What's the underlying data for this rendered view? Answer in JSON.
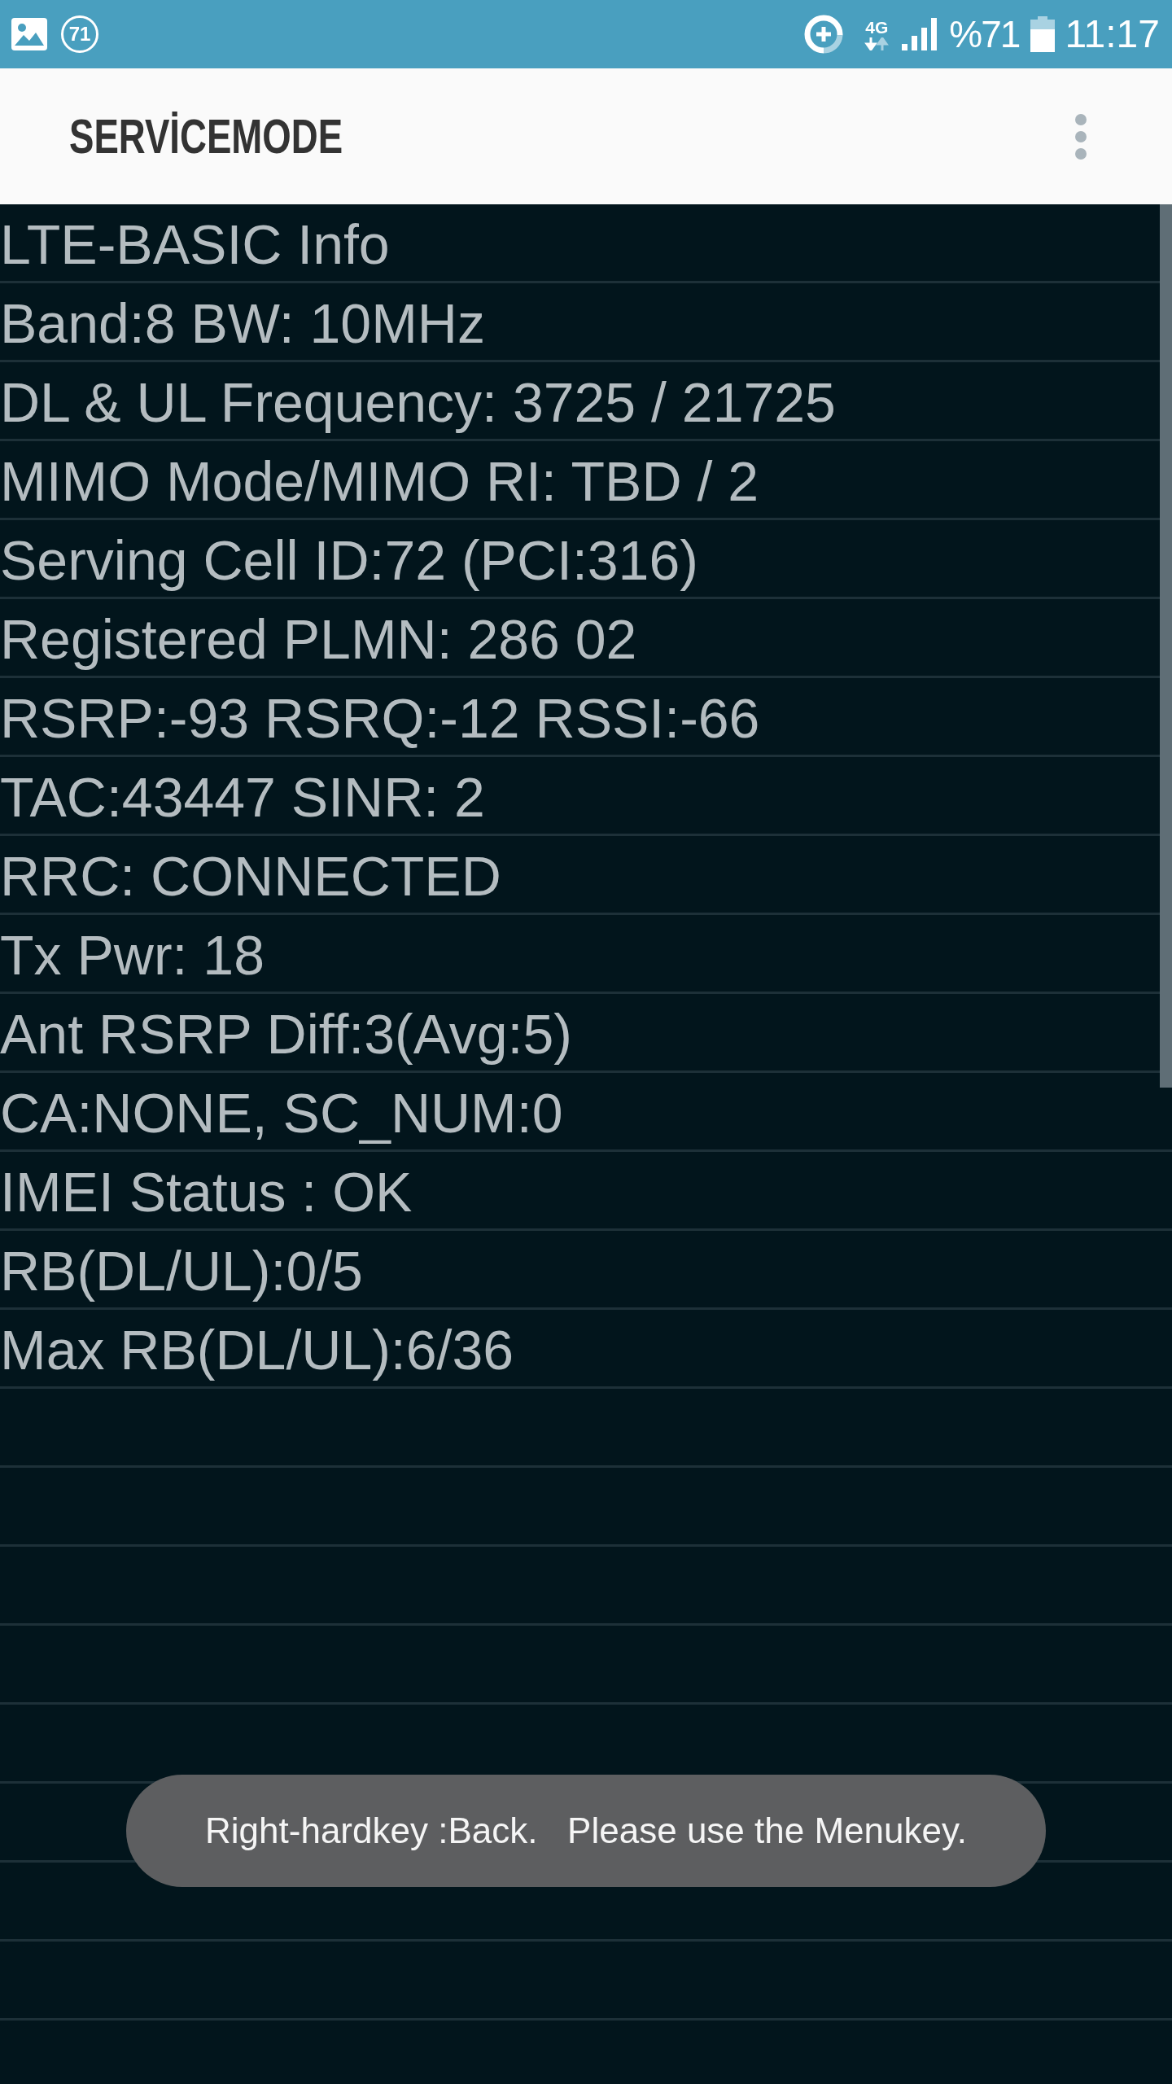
{
  "status_bar": {
    "notification_count": "71",
    "network_type": "4G",
    "battery_percent": "%71",
    "time": "11:17"
  },
  "app_bar": {
    "title": "SERVİCEMODE"
  },
  "info_rows": [
    "LTE-BASIC Info",
    "Band:8 BW: 10MHz",
    "DL & UL Frequency: 3725 / 21725",
    "MIMO Mode/MIMO RI: TBD / 2",
    "Serving Cell ID:72 (PCI:316)",
    "Registered PLMN: 286 02",
    "RSRP:-93 RSRQ:-12 RSSI:-66",
    "TAC:43447 SINR: 2",
    "RRC: CONNECTED",
    "Tx Pwr: 18",
    "Ant RSRP Diff:3(Avg:5)",
    "CA:NONE, SC_NUM:0",
    "IMEI Status : OK",
    "RB(DL/UL):0/5",
    "Max RB(DL/UL):6/36"
  ],
  "toast": {
    "text": "Right-hardkey :Back.   Please use the Menukey."
  }
}
